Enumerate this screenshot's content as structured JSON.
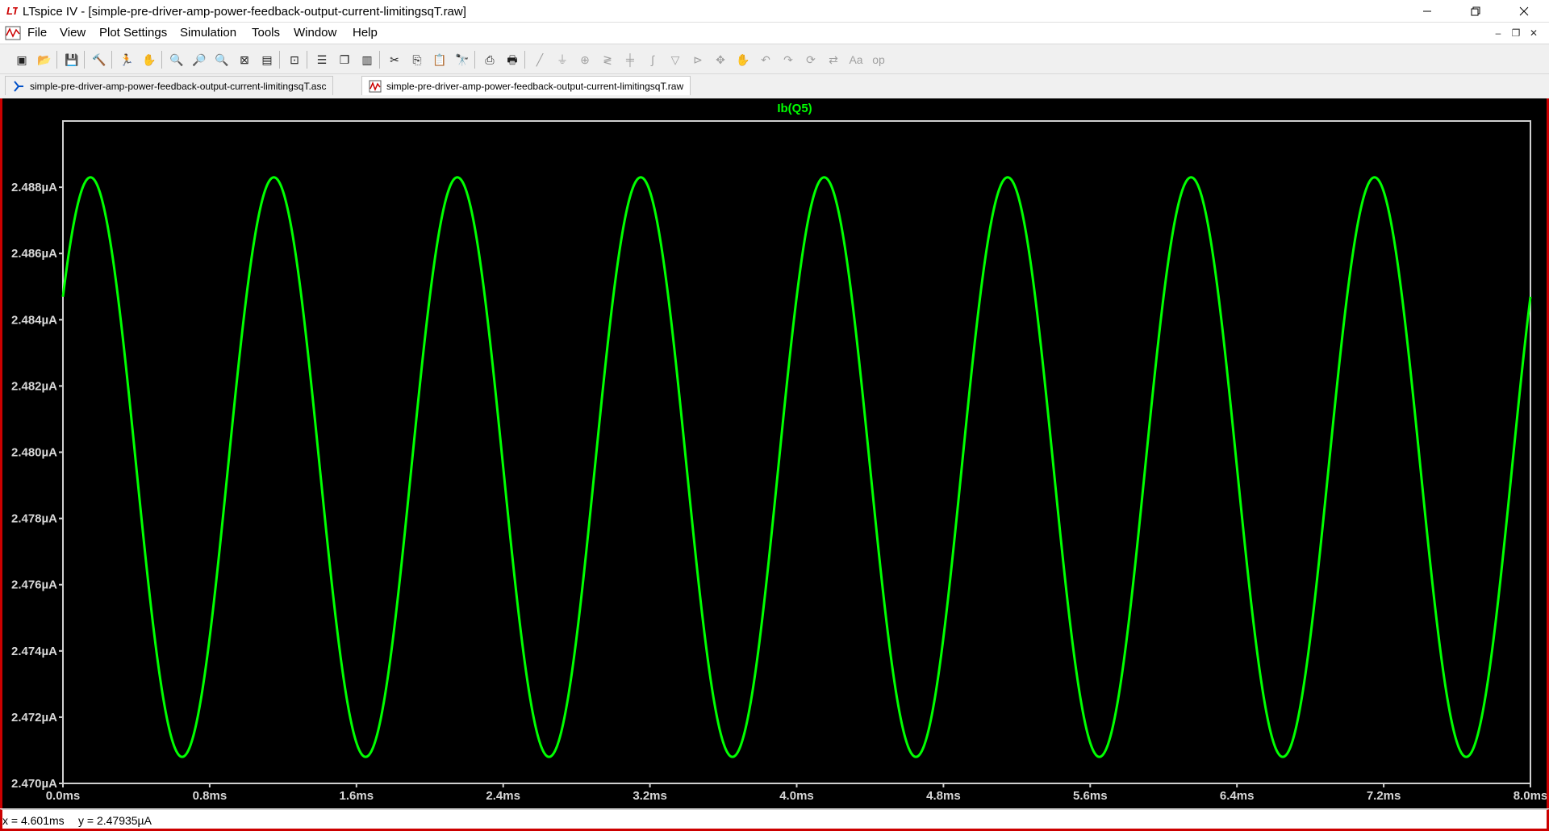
{
  "window": {
    "title": "LTspice IV - [simple-pre-driver-amp-power-feedback-output-current-limitingsqT.raw]",
    "minimize_icon": "minimize-icon",
    "maximize_icon": "restore-icon",
    "close_icon": "close-icon"
  },
  "menu": {
    "items": [
      {
        "label": "File"
      },
      {
        "label": "View"
      },
      {
        "label": "Plot Settings"
      },
      {
        "label": "Simulation"
      },
      {
        "label": "Tools"
      },
      {
        "label": "Window"
      },
      {
        "label": "Help"
      }
    ]
  },
  "tabs": [
    {
      "label": "simple-pre-driver-amp-power-feedback-output-current-limitingsqT.asc",
      "icon": "schematic-icon",
      "active": false
    },
    {
      "label": "simple-pre-driver-amp-power-feedback-output-current-limitingsqT.raw",
      "icon": "waveform-icon",
      "active": true
    }
  ],
  "colors": {
    "trace": "#00ff00",
    "plot_bg": "#000000",
    "axis": "#ffffff",
    "frame": "#cc0000"
  },
  "chart_data": {
    "type": "line",
    "title": "Ib(Q5)",
    "xlabel": "",
    "ylabel": "",
    "xlim": [
      0.0,
      8.0
    ],
    "ylim": [
      2.47,
      2.49
    ],
    "x_unit": "ms",
    "y_unit": "µA",
    "x_ticks": [
      "0.0ms",
      "0.8ms",
      "1.6ms",
      "2.4ms",
      "3.2ms",
      "4.0ms",
      "4.8ms",
      "5.6ms",
      "6.4ms",
      "7.2ms",
      "8.0ms"
    ],
    "y_ticks": [
      "2.470µA",
      "2.472µA",
      "2.474µA",
      "2.476µA",
      "2.478µA",
      "2.480µA",
      "2.482µA",
      "2.484µA",
      "2.486µA",
      "2.488µA"
    ],
    "series": [
      {
        "name": "Ib(Q5)",
        "waveform": "sine",
        "max": 2.4883,
        "min": 2.4708,
        "period_ms": 1.0,
        "first_peak_ms": 0.15
      }
    ],
    "grid": false
  },
  "status": {
    "x": "x = 4.601ms",
    "y": "y = 2.47935µA"
  },
  "toolbar": {
    "icons": [
      "new-schematic-icon",
      "open-icon",
      "save-icon",
      "control-panel-icon",
      "run-icon",
      "pan-icon",
      "zoom-in-icon",
      "zoom-area-icon",
      "zoom-out-icon",
      "zoom-fit-icon",
      "autorange-icon",
      "mark-data-icon",
      "tile-horizontal-icon",
      "cascade-icon",
      "tile-vertical-icon",
      "cut-icon",
      "copy-icon",
      "paste-icon",
      "find-icon",
      "print-preview-icon",
      "print-icon",
      "wire-icon",
      "ground-icon",
      "label-icon",
      "resistor-icon",
      "capacitor-icon",
      "inductor-icon",
      "diode-icon",
      "component-icon",
      "move-icon",
      "drag-icon",
      "undo-icon",
      "redo-icon",
      "rotate-icon",
      "mirror-icon",
      "text-icon",
      "spice-directive-icon"
    ]
  }
}
